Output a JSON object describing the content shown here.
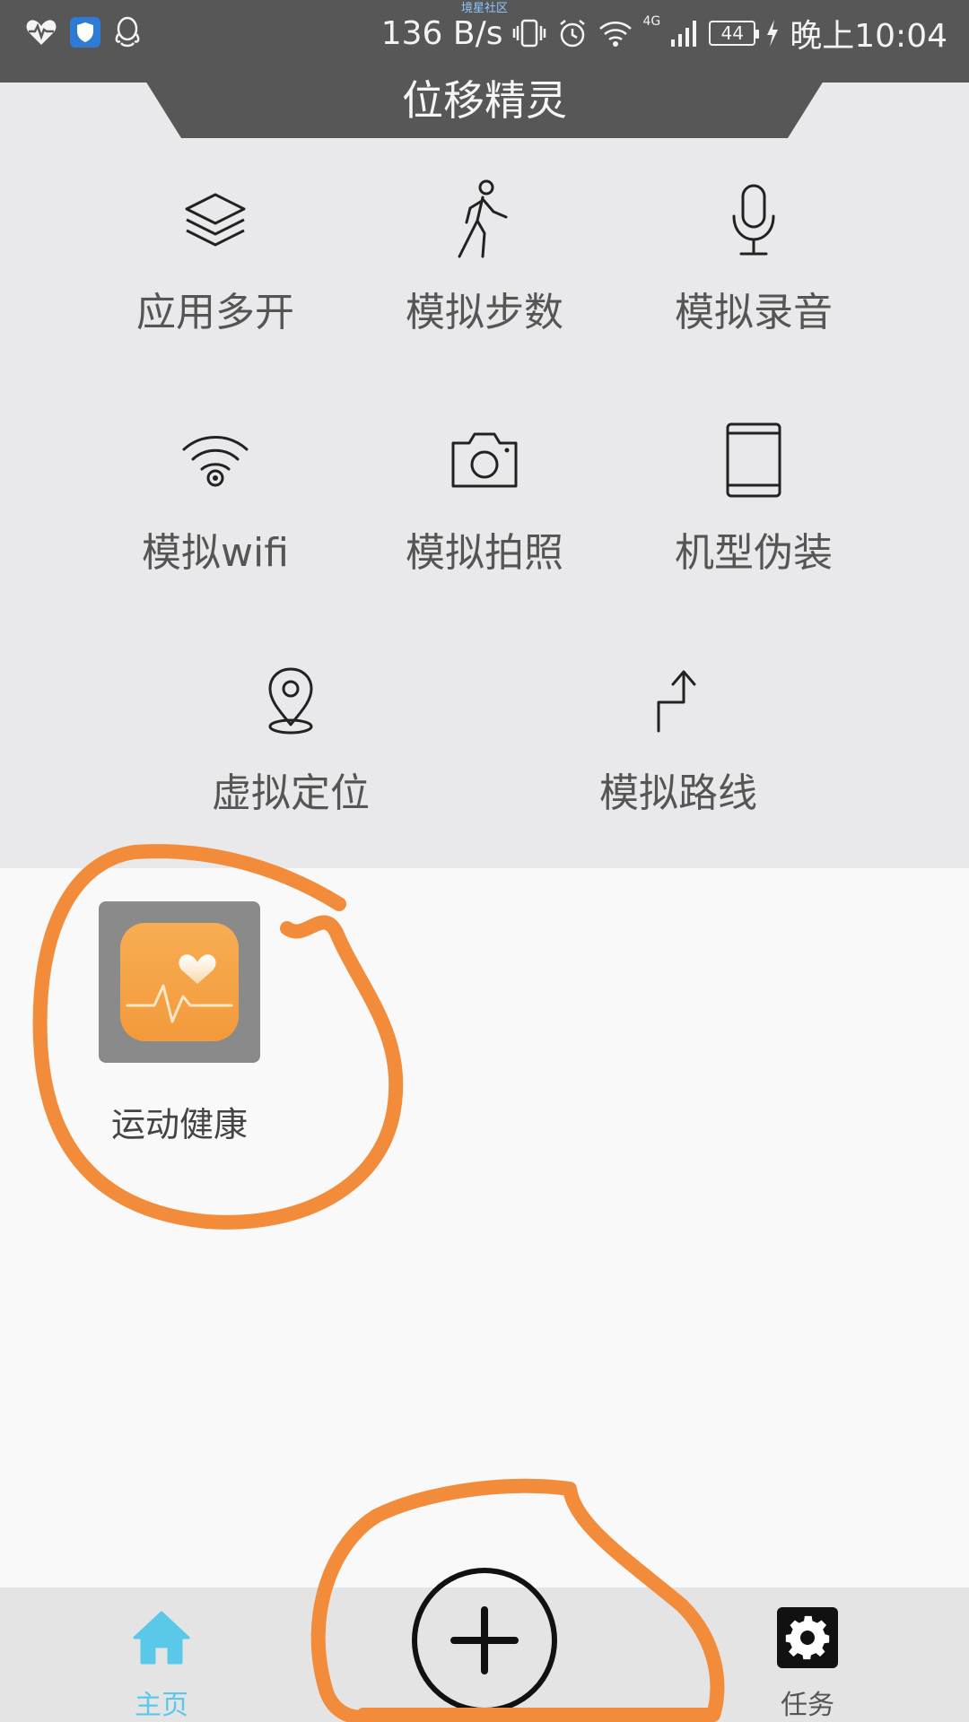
{
  "status_bar": {
    "network_speed": "136 B/s",
    "network_type": "4G",
    "battery": "44",
    "time": "晚上10:04",
    "watermark": "境星社区"
  },
  "header": {
    "title": "位移精灵"
  },
  "features": [
    {
      "label": "应用多开",
      "icon": "layers-icon"
    },
    {
      "label": "模拟步数",
      "icon": "walking-person-icon"
    },
    {
      "label": "模拟录音",
      "icon": "microphone-icon"
    },
    {
      "label": "模拟wifi",
      "icon": "wifi-icon"
    },
    {
      "label": "模拟拍照",
      "icon": "camera-icon"
    },
    {
      "label": "机型伪装",
      "icon": "tablet-icon"
    },
    {
      "label": "虚拟定位",
      "icon": "location-pin-icon"
    },
    {
      "label": "模拟路线",
      "icon": "route-arrow-icon"
    }
  ],
  "apps": [
    {
      "label": "运动健康",
      "icon": "health-heart-icon"
    }
  ],
  "bottom_nav": {
    "home_label": "主页",
    "task_label": "任务",
    "home_color": "#5ac8e8"
  },
  "colors": {
    "status_bar": "#575757",
    "feature_bg": "#e9e9eb",
    "content_bg": "#f9f9f9",
    "app_icon_orange": "#f5a044",
    "annotation_orange": "#f28c3a"
  }
}
